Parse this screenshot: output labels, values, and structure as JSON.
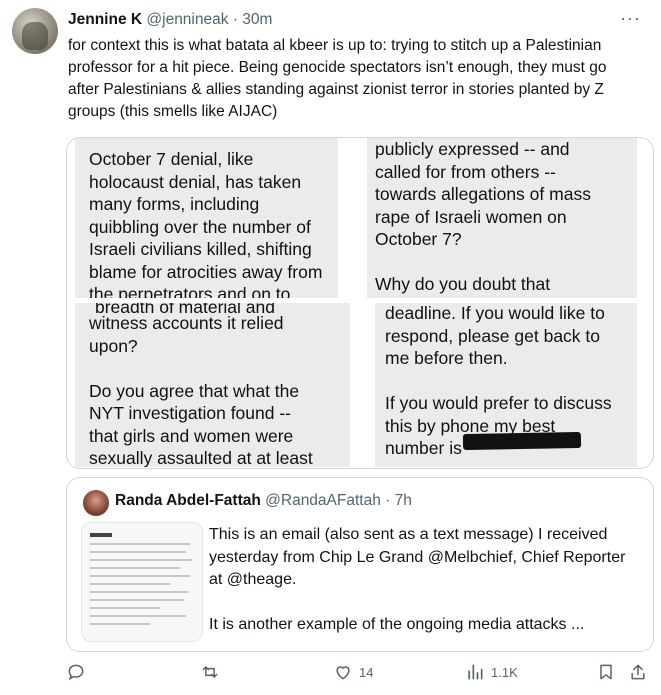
{
  "tweet": {
    "author_name": "Jennine K",
    "author_handle": "@jennineak",
    "separator": "·",
    "time": "30m",
    "more": "···",
    "text": "for context this is what batata al kbeer is up to: trying to stitch up a Palestinian professor for a hit piece. Being genocide spectators isn’t enough, they must go after Palestinians & allies standing against zionist terror in stories planted by Z groups (this smells like AIJAC)"
  },
  "media": {
    "shot1": "October 7 denial, like\nholocaust denial, has taken\nmany forms, including\nquibbling over the number of\nIsraeli civilians killed, shifting\nblame for atrocities away from\nthe perpetrators and on to",
    "shot2": "publicly expressed -- and\ncalled for from others --\ntowards allegations of mass\nrape of Israeli women on\nOctober 7?\n\nWhy do you doubt that",
    "shot3_cut": "breadth of material and",
    "shot3": "witness accounts it relied\nupon?\n\nDo you agree that what the\nNYT investigation found --\nthat girls and women were\nsexually assaulted at at least",
    "shot4": "deadline. If you would like to\nrespond, please get back to\nme before then.\n\nIf you would prefer to discuss\nthis by phone my best\nnumber is"
  },
  "quote": {
    "author_name": "Randa Abdel-Fattah",
    "author_handle": "@RandaAFattah",
    "separator": "·",
    "time": "7h",
    "text": "This is an email (also sent as a text message) I received yesterday from Chip Le Grand @Melbchief, Chief Reporter at @theage.\n\nIt is another example of the ongoing media attacks ..."
  },
  "actions": {
    "reply_icon": "reply-icon",
    "retweet_icon": "retweet-icon",
    "like_icon": "heart-icon",
    "like_count": "14",
    "views_icon": "views-icon",
    "views_count": "1.1K",
    "bookmark_icon": "bookmark-icon",
    "share_icon": "share-icon"
  },
  "colors": {
    "text": "#0f1419",
    "muted": "#536471",
    "border": "#cfd9de",
    "screenshot_bg": "#ebebeb"
  }
}
